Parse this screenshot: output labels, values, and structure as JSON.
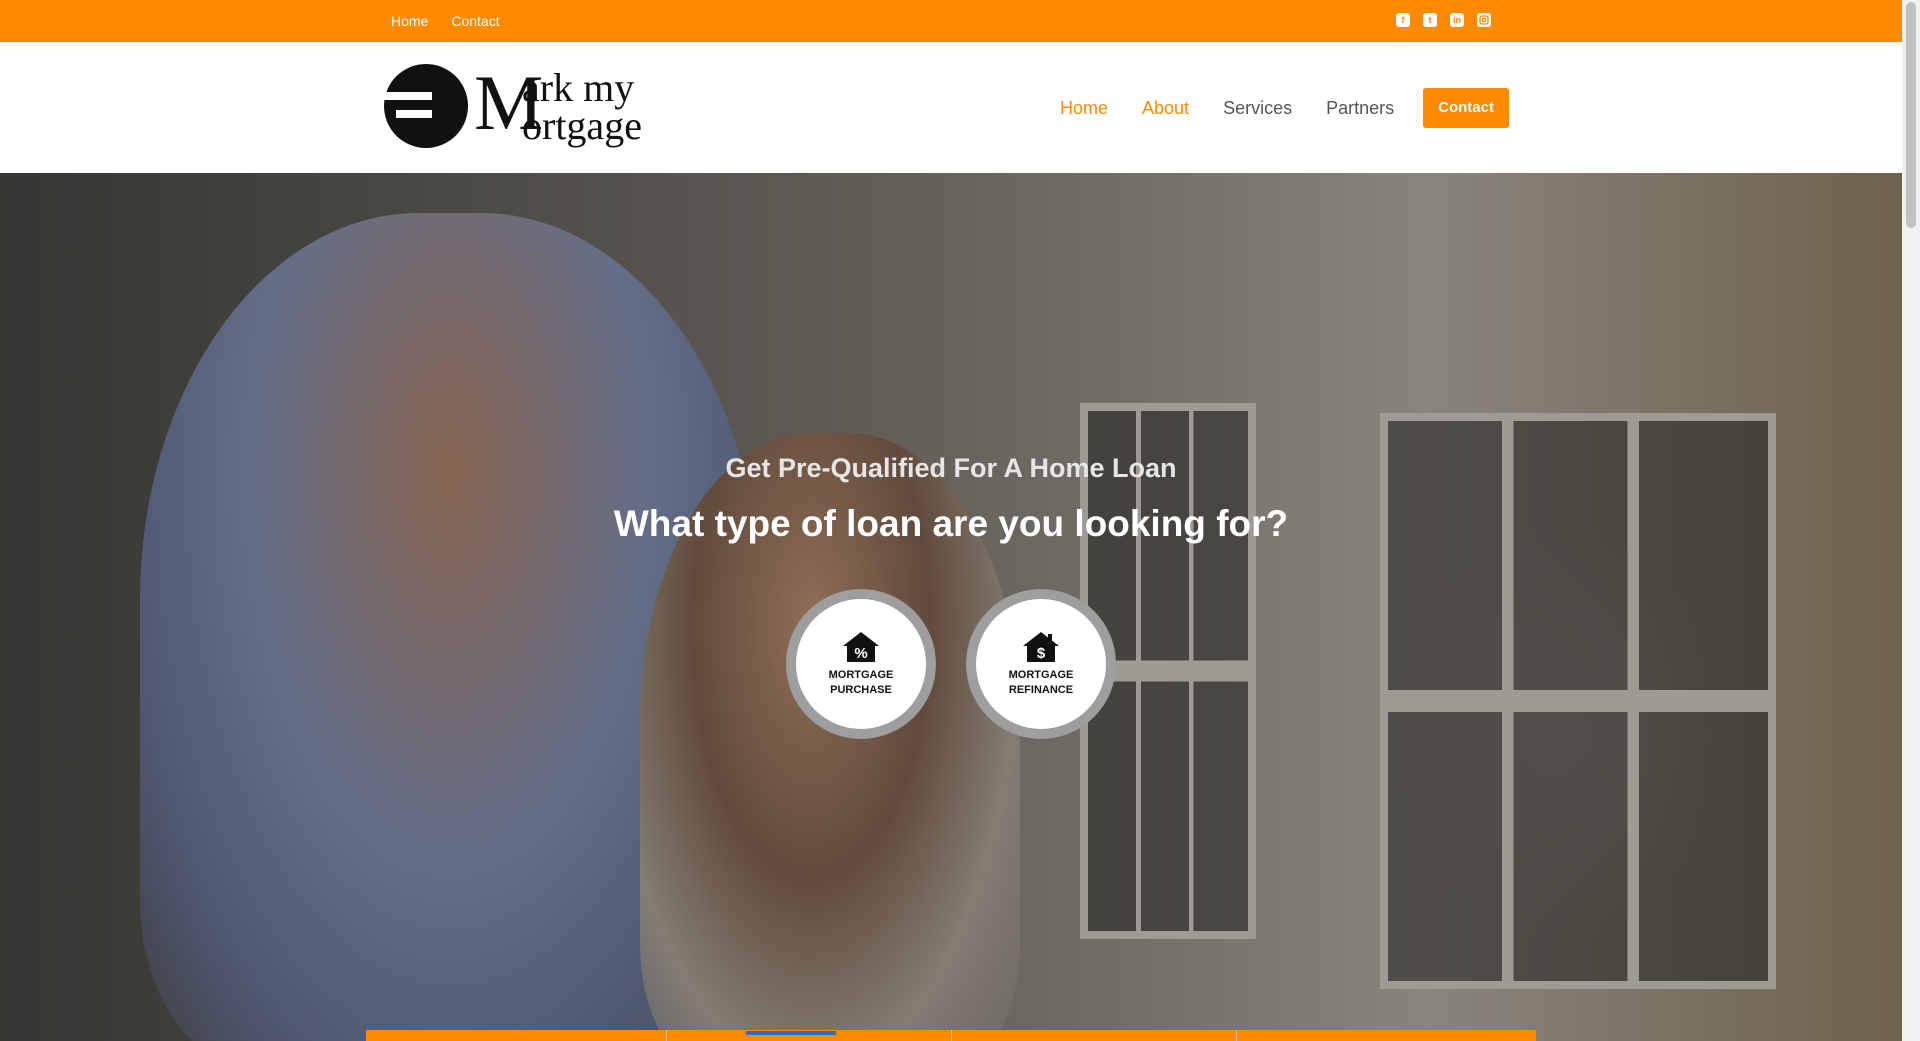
{
  "topbar": {
    "links": [
      "Home",
      "Contact"
    ],
    "social_icons": [
      "facebook-icon",
      "twitter-icon",
      "linkedin-icon",
      "instagram-icon"
    ],
    "color": "#ff8a00"
  },
  "brand": {
    "line1": "ark my",
    "line2": "ortgage",
    "initial": "M"
  },
  "nav": {
    "items": [
      "Home",
      "About",
      "Services",
      "Partners"
    ],
    "cta": "Contact"
  },
  "hero": {
    "subtitle": "Get Pre-Qualified For A Home Loan",
    "title": "What type of loan are you looking for?",
    "options": [
      {
        "label": "MORTGAGE\nPURCHASE",
        "icon": "house-percent-icon"
      },
      {
        "label": "MORTGAGE\nREFINANCE",
        "icon": "house-dollar-icon"
      }
    ]
  },
  "colors": {
    "accent": "#ff8a00",
    "nav_text": "#555555"
  }
}
